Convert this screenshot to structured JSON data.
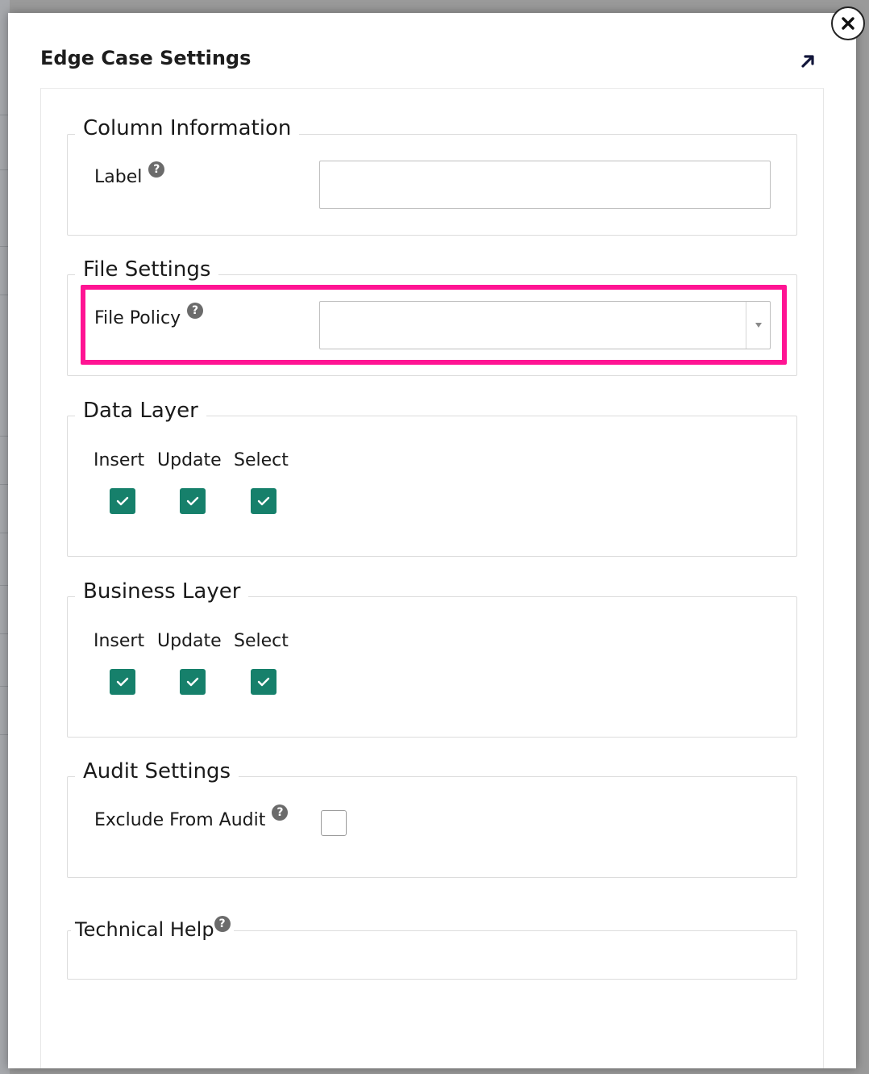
{
  "modal": {
    "title": "Edge Case Settings",
    "close_icon": "close-icon",
    "expand_icon": "arrow-up-right-icon"
  },
  "column_information": {
    "legend": "Column Information",
    "label_field": {
      "label": "Label",
      "value": "",
      "help_icon": "question-circle-icon"
    }
  },
  "file_settings": {
    "legend": "File Settings",
    "file_policy": {
      "label": "File Policy",
      "value": "",
      "help_icon": "question-circle-icon",
      "dropdown_icon": "caret-down-icon"
    },
    "highlight_color": "#ff1493"
  },
  "data_layer": {
    "legend": "Data Layer",
    "columns": [
      {
        "label": "Insert",
        "checked": true
      },
      {
        "label": "Update",
        "checked": true
      },
      {
        "label": "Select",
        "checked": true
      }
    ]
  },
  "business_layer": {
    "legend": "Business Layer",
    "columns": [
      {
        "label": "Insert",
        "checked": true
      },
      {
        "label": "Update",
        "checked": true
      },
      {
        "label": "Select",
        "checked": true
      }
    ]
  },
  "audit_settings": {
    "legend": "Audit Settings",
    "exclude_from_audit": {
      "label": "Exclude From Audit",
      "checked": false,
      "help_icon": "question-circle-icon"
    }
  },
  "technical_help": {
    "legend": "Technical Help",
    "help_icon": "question-circle-icon"
  },
  "colors": {
    "checkbox_checked": "#16806b",
    "highlight": "#ff1493"
  }
}
